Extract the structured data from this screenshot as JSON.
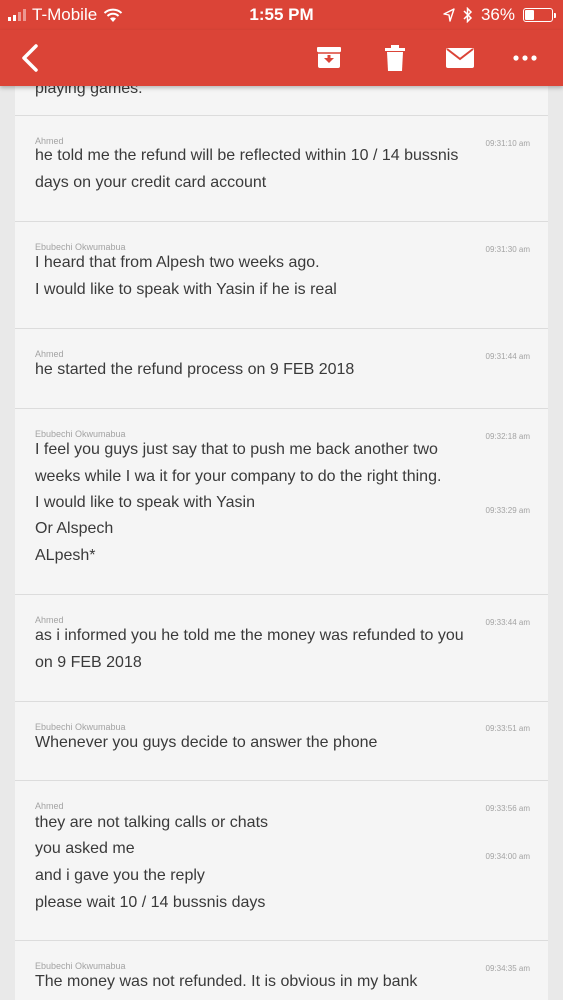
{
  "status_bar": {
    "carrier": "T-Mobile",
    "time": "1:55 PM",
    "battery": "36%",
    "battery_level": 0.36
  },
  "toolbar": {
    "back_icon": "back-arrow-icon",
    "archive_icon": "archive-icon",
    "delete_icon": "trash-icon",
    "mail_icon": "mail-icon",
    "more_icon": "more-icon"
  },
  "colors": {
    "brand": "#db4437",
    "card": "#f5f5f5",
    "text": "#3a3a3a",
    "meta": "#a3a3a3"
  },
  "partial_line": "playing games.",
  "messages": [
    {
      "sender": "Ahmed",
      "times": [
        "09:31:10 am"
      ],
      "lines": [
        "he told me the refund will be reflected within 10 / 14 bussnis",
        "days on your credit card account"
      ]
    },
    {
      "sender": "Ebubechi Okwumabua",
      "times": [
        "09:31:30 am"
      ],
      "lines": [
        "I heard that from Alpesh two weeks ago.",
        "I would like to speak with Yasin if he is real"
      ]
    },
    {
      "sender": "Ahmed",
      "times": [
        "09:31:44 am"
      ],
      "lines": [
        "he started the refund process on 9 FEB 2018"
      ]
    },
    {
      "sender": "Ebubechi Okwumabua",
      "times": [
        "09:32:18 am",
        "09:33:29 am"
      ],
      "lines": [
        "I feel you guys just say that to push me back another two",
        "weeks while I wa it for your company to do the right thing.",
        "I would like to speak with Yasin",
        "Or Alspech",
        "ALpesh*"
      ]
    },
    {
      "sender": "Ahmed",
      "times": [
        "09:33:44 am"
      ],
      "lines": [
        "as i informed you he told me the money was refunded to you",
        "on 9 FEB 2018"
      ]
    },
    {
      "sender": "Ebubechi Okwumabua",
      "times": [
        "09:33:51 am"
      ],
      "lines": [
        "Whenever you guys decide to answer the phone"
      ]
    },
    {
      "sender": "Ahmed",
      "times": [
        "09:33:56 am",
        "09:34:00 am"
      ],
      "lines": [
        "they are not talking calls or chats",
        "you asked me",
        "and i gave you the reply",
        "please wait 10 / 14 bussnis days"
      ]
    },
    {
      "sender": "Ebubechi Okwumabua",
      "times": [
        "09:34:35 am"
      ],
      "lines": [
        "The money was not refunded. It is obvious in my bank"
      ]
    }
  ]
}
